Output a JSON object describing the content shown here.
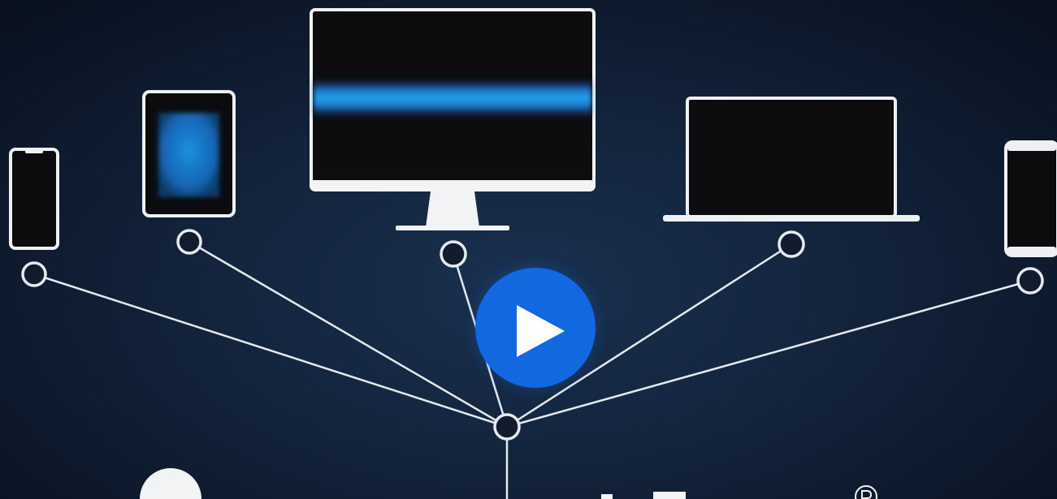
{
  "video": {
    "play_label": "Play video",
    "accent_color": "#1268e0",
    "screen_glow_color": "#1e88d8"
  },
  "devices": [
    {
      "name": "phone-left",
      "icon": "smartphone-icon"
    },
    {
      "name": "tablet",
      "icon": "tablet-icon"
    },
    {
      "name": "desktop-monitor",
      "icon": "monitor-icon"
    },
    {
      "name": "laptop",
      "icon": "laptop-icon"
    },
    {
      "name": "phone-right",
      "icon": "smartphone-icon"
    }
  ],
  "network": {
    "line_color": "#e6e9ee"
  }
}
